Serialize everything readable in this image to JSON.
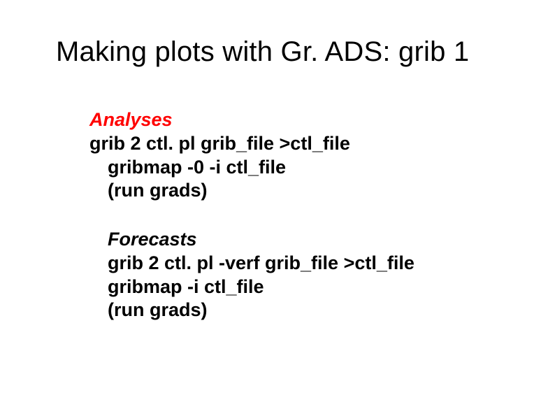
{
  "title": "Making plots with Gr. ADS: grib 1",
  "section1": {
    "heading": "Analyses",
    "line1": "grib 2 ctl. pl grib_file >ctl_file",
    "line2": "gribmap -0 -i ctl_file",
    "line3": "(run grads)"
  },
  "section2": {
    "heading": "Forecasts",
    "line1": "grib 2 ctl. pl -verf grib_file >ctl_file",
    "line2": "gribmap -i ctl_file",
    "line3": "(run grads)"
  }
}
